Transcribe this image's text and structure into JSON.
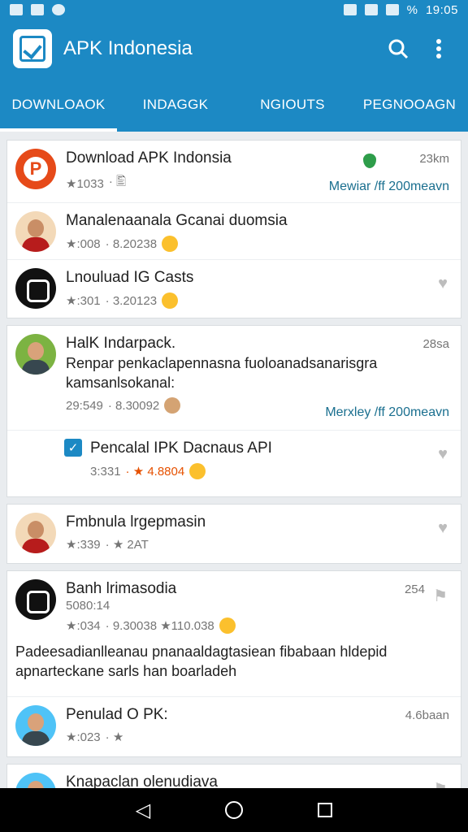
{
  "status_bar": {
    "time": "19:05",
    "battery": "%"
  },
  "app_bar": {
    "title": "APK Indonesia",
    "search_icon": "search-icon",
    "menu_icon": "more-vert-icon"
  },
  "tabs": [
    {
      "label": "DOWNLOAOK",
      "active": true
    },
    {
      "label": "INDAGGK",
      "active": false
    },
    {
      "label": "NGIOUTS",
      "active": false
    },
    {
      "label": "PEGNOOAGN",
      "active": false
    }
  ],
  "cards": [
    {
      "rows": [
        {
          "title": "Download APK Indonsia",
          "rating": "★1033",
          "extra": "· 🖺",
          "side": "23km",
          "link": "Mewiar /ff 200meavn"
        },
        {
          "title": "Manalenaanala Gcanai duomsia",
          "rating": "★:008",
          "extra": "· 8.20238"
        },
        {
          "title": "Lnouluad IG Casts",
          "rating": "★:301",
          "extra": "· 3.20123"
        }
      ]
    },
    {
      "rows": [
        {
          "title": "HalK Indarpack.",
          "desc": "Renpar penkaclapennasna fuoloanadsanarisgra kamsanlsokanal:",
          "rating": "29:549",
          "extra": "· 8.30092",
          "side": "28sa",
          "link": "Merxley /ff 200meavn"
        },
        {
          "title": "Pencalal IPK Dacnaus API",
          "rating": "3:331",
          "extra": "· ★ 4.8804"
        }
      ]
    },
    {
      "rows": [
        {
          "title": "Fmbnula lrgepmasin",
          "rating": "★:339",
          "extra": "· ★ 2AT"
        }
      ]
    },
    {
      "rows": [
        {
          "title": "Banh lrimasodia",
          "subtitle": "5080:14",
          "rating": "★:034",
          "extra": "· 9.30038  ★110.038",
          "side": "254",
          "desc": "Padeesadianlleanau pnanaaldagtasiean fibabaan hldepid apnarteckane sarls han boarladeh"
        },
        {
          "title": "Penulad O PK:",
          "rating": "★:023",
          "extra": "· ★",
          "side": "4.6baan"
        }
      ]
    },
    {
      "rows": [
        {
          "title": "Knapaclan olenudiava"
        }
      ]
    }
  ],
  "navbar": {
    "back": "◁"
  }
}
